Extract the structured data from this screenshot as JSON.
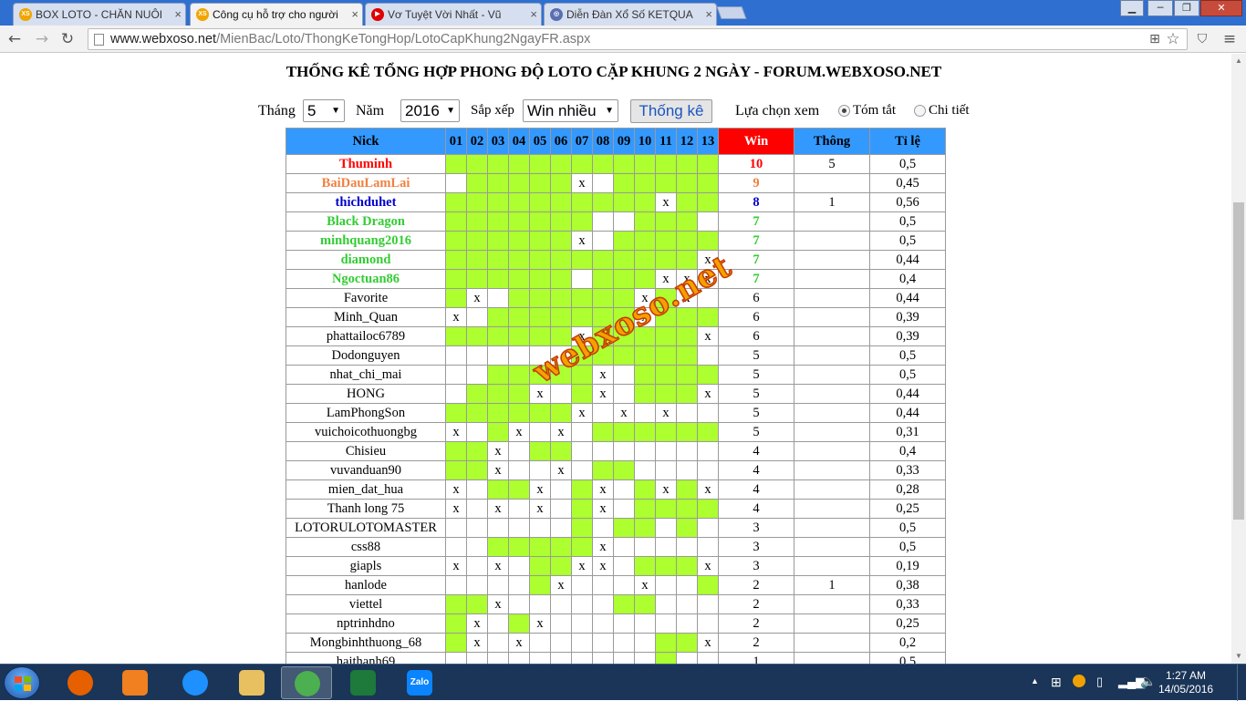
{
  "browser": {
    "tabs": [
      {
        "label": "BOX LOTO - CHĂN NUÔI",
        "fav": "XS",
        "favcolor": "#f0a500",
        "active": false
      },
      {
        "label": "Công cụ hỗ trợ cho người",
        "fav": "XS",
        "favcolor": "#f0a500",
        "active": true
      },
      {
        "label": "Vơ Tuyệt Vời Nhất - Vũ",
        "fav": "▶",
        "favcolor": "#e00000",
        "active": false
      },
      {
        "label": "Diễn Đàn Xổ Số KETQUA",
        "fav": "◎",
        "favcolor": "#5a6fb0",
        "active": false
      }
    ],
    "url_host": "www.webxoso.net",
    "url_path": "/MienBac/Loto/ThongKeTongHop/LotoCapKhung2NgayFR.aspx"
  },
  "page": {
    "title": "THỐNG KÊ TỔNG HỢP PHONG ĐỘ LOTO CẶP KHUNG 2 NGÀY - FORUM.WEBXOSO.NET",
    "controls": {
      "thang_label": "Tháng",
      "thang_value": "5",
      "nam_label": "Năm",
      "nam_value": "2016",
      "sapxep_label": "Sắp xếp",
      "sapxep_value": "Win nhiều",
      "submit_label": "Thống kê",
      "view_label": "Lựa chọn xem",
      "opt_summary": "Tóm tắt",
      "opt_detail": "Chi tiết",
      "selected_view": "Tóm tắt"
    },
    "watermark": "webxoso.net"
  },
  "table": {
    "headers": {
      "nick": "Nick",
      "win": "Win",
      "thong": "Thông",
      "tile": "Tỉ lệ"
    },
    "days": [
      "01",
      "02",
      "03",
      "04",
      "05",
      "06",
      "07",
      "08",
      "09",
      "10",
      "11",
      "12",
      "13"
    ],
    "rows": [
      {
        "nick": "Thuminh",
        "color": "#ff0000",
        "bold": true,
        "cells": "hhhhhhhhhhhhh",
        "win": "10",
        "thong": "5",
        "tile": "0,5"
      },
      {
        "nick": "BaiDauLamLai",
        "color": "#f08040",
        "bold": true,
        "cells": ".hhhhhx.hhhhh",
        "win": "9",
        "thong": "",
        "tile": "0,45"
      },
      {
        "nick": "thichduhet",
        "color": "#0000cc",
        "bold": true,
        "cells": "hhhhhhhhhhxhh",
        "win": "8",
        "thong": "1",
        "tile": "0,56"
      },
      {
        "nick": "Black Dragon",
        "color": "#33cc33",
        "bold": true,
        "cells": "hhhhhhh..hhh.",
        "win": "7",
        "thong": "",
        "tile": "0,5"
      },
      {
        "nick": "minhquang2016",
        "color": "#33cc33",
        "bold": true,
        "cells": "hhhhhhx.hhhhh",
        "win": "7",
        "thong": "",
        "tile": "0,5"
      },
      {
        "nick": "diamond",
        "color": "#33cc33",
        "bold": true,
        "cells": "hhhhhhhhhhhhx",
        "win": "7",
        "thong": "",
        "tile": "0,44"
      },
      {
        "nick": "Ngoctuan86",
        "color": "#33cc33",
        "bold": true,
        "cells": "hhhhhh.hhhxxx",
        "win": "7",
        "thong": "",
        "tile": "0,4"
      },
      {
        "nick": "Favorite",
        "color": "#000000",
        "bold": false,
        "cells": "hx.hhhhhhxhx.",
        "win": "6",
        "thong": "",
        "tile": "0,44"
      },
      {
        "nick": "Minh_Quan",
        "color": "#000000",
        "bold": false,
        "cells": "x.hhhhhhhxhhh",
        "win": "6",
        "thong": "",
        "tile": "0,39"
      },
      {
        "nick": "phattailoc6789",
        "color": "#000000",
        "bold": false,
        "cells": "hhhhhhxhhhhhx",
        "win": "6",
        "thong": "",
        "tile": "0,39"
      },
      {
        "nick": "Dodonguyen",
        "color": "#000000",
        "bold": false,
        "cells": "......hhhhhh.",
        "win": "5",
        "thong": "",
        "tile": "0,5"
      },
      {
        "nick": "nhat_chi_mai",
        "color": "#000000",
        "bold": false,
        "cells": "..hhhhhx.hhhh",
        "win": "5",
        "thong": "",
        "tile": "0,5"
      },
      {
        "nick": "HONG",
        "color": "#000000",
        "bold": false,
        "cells": ".hhhx.hx.hhhx",
        "win": "5",
        "thong": "",
        "tile": "0,44"
      },
      {
        "nick": "LamPhongSon",
        "color": "#000000",
        "bold": false,
        "cells": "hhhhhhx.x.x..",
        "win": "5",
        "thong": "",
        "tile": "0,44"
      },
      {
        "nick": "vuichoicothuongbg",
        "color": "#000000",
        "bold": false,
        "cells": "x.hx.x.hhhhhh",
        "win": "5",
        "thong": "",
        "tile": "0,31"
      },
      {
        "nick": "Chisieu",
        "color": "#000000",
        "bold": false,
        "cells": "hhx.hh.......",
        "win": "4",
        "thong": "",
        "tile": "0,4"
      },
      {
        "nick": "vuvanduan90",
        "color": "#000000",
        "bold": false,
        "cells": "hhx..x.hh....",
        "win": "4",
        "thong": "",
        "tile": "0,33"
      },
      {
        "nick": "mien_dat_hua",
        "color": "#000000",
        "bold": false,
        "cells": "x.hhx.hx.hxhx",
        "win": "4",
        "thong": "",
        "tile": "0,28"
      },
      {
        "nick": "Thanh long 75",
        "color": "#000000",
        "bold": false,
        "cells": "x.x.x.hx.hhhh",
        "win": "4",
        "thong": "",
        "tile": "0,25"
      },
      {
        "nick": "LOTORULOTOMASTER",
        "color": "#000000",
        "bold": false,
        "cells": "......h.hh.h.",
        "win": "3",
        "thong": "",
        "tile": "0,5"
      },
      {
        "nick": "css88",
        "color": "#000000",
        "bold": false,
        "cells": "..hhhhhx.....",
        "win": "3",
        "thong": "",
        "tile": "0,5"
      },
      {
        "nick": "giapls",
        "color": "#000000",
        "bold": false,
        "cells": "x.x.hhxx.hhhx",
        "win": "3",
        "thong": "",
        "tile": "0,19"
      },
      {
        "nick": "hanlode",
        "color": "#000000",
        "bold": false,
        "cells": "....hx...x..h",
        "win": "2",
        "thong": "1",
        "tile": "0,38"
      },
      {
        "nick": "viettel",
        "color": "#000000",
        "bold": false,
        "cells": "hhx.....hh...",
        "win": "2",
        "thong": "",
        "tile": "0,33"
      },
      {
        "nick": "nptrinhdno",
        "color": "#000000",
        "bold": false,
        "cells": "hx.hx........",
        "win": "2",
        "thong": "",
        "tile": "0,25"
      },
      {
        "nick": "Mongbinhthuong_68",
        "color": "#000000",
        "bold": false,
        "cells": "hx.x......hhx",
        "win": "2",
        "thong": "",
        "tile": "0,2"
      },
      {
        "nick": "haithanh69",
        "color": "#000000",
        "bold": false,
        "cells": "..........h..",
        "win": "1",
        "thong": "",
        "tile": "0,5"
      }
    ]
  },
  "taskbar": {
    "time": "1:27 AM",
    "date": "14/05/2016",
    "apps": [
      {
        "name": "firefox",
        "color": "#e66000"
      },
      {
        "name": "media-player",
        "color": "#f08020"
      },
      {
        "name": "internet-explorer",
        "color": "#1e90ff"
      },
      {
        "name": "file-explorer",
        "color": "#e8c060"
      },
      {
        "name": "chrome",
        "color": "#4caf50"
      },
      {
        "name": "excel",
        "color": "#1d7a3a"
      },
      {
        "name": "zalo",
        "color": "#0a84ff"
      }
    ],
    "zalo_label": "Zalo"
  }
}
